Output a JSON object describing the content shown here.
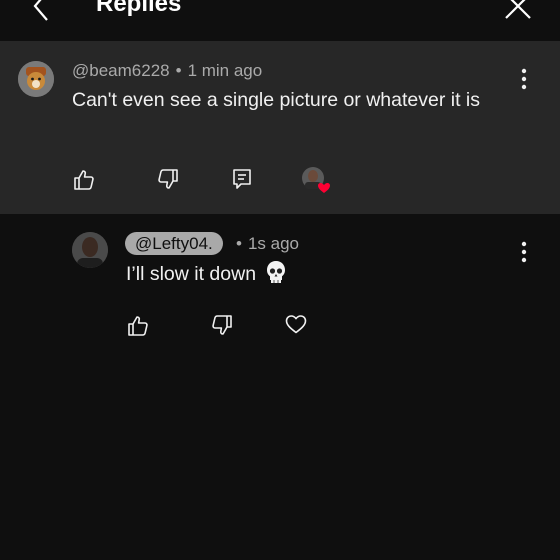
{
  "header": {
    "title": "Replies",
    "back_icon": "chevron-left-icon",
    "close_icon": "close-icon"
  },
  "parent_comment": {
    "author": "@beam6228",
    "time": "1 min ago",
    "text": "Can't even see a single picture or whatever it is"
  },
  "reply": {
    "author": "@Lefty04.",
    "time": "1s ago",
    "text": "I’ll slow it down",
    "emoji": "skull-icon"
  },
  "colors": {
    "background": "#0f0f0f",
    "highlight": "#272727",
    "heart": "#ff0033"
  }
}
